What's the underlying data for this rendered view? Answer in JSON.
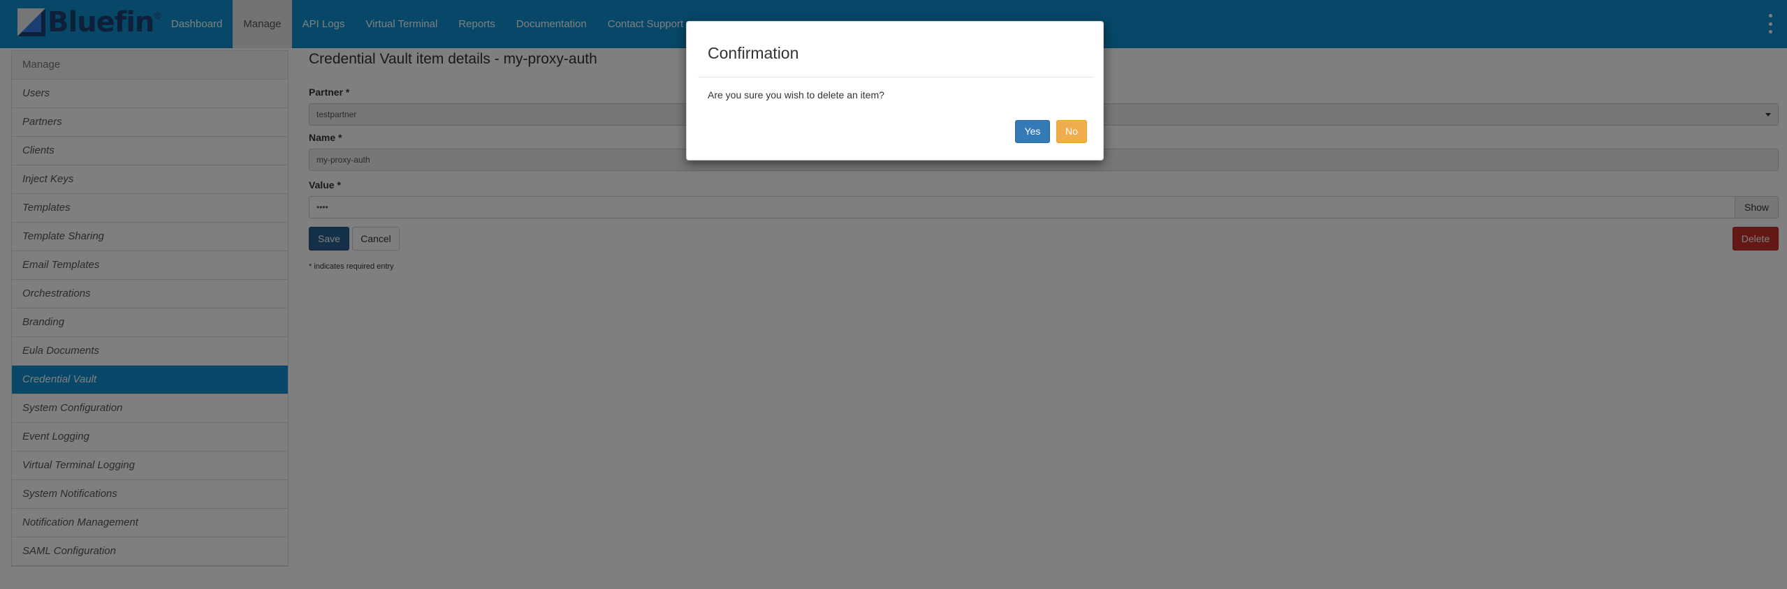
{
  "brand": {
    "name": "Bluefin",
    "reg": "®"
  },
  "nav": {
    "items": [
      {
        "label": "Dashboard"
      },
      {
        "label": "Manage",
        "active": true
      },
      {
        "label": "API Logs"
      },
      {
        "label": "Virtual Terminal"
      },
      {
        "label": "Reports"
      },
      {
        "label": "Documentation"
      },
      {
        "label": "Contact Support"
      }
    ]
  },
  "sidebar": {
    "header": "Manage",
    "items": [
      {
        "label": "Users"
      },
      {
        "label": "Partners"
      },
      {
        "label": "Clients"
      },
      {
        "label": "Inject Keys"
      },
      {
        "label": "Templates"
      },
      {
        "label": "Template Sharing"
      },
      {
        "label": "Email Templates"
      },
      {
        "label": "Orchestrations"
      },
      {
        "label": "Branding"
      },
      {
        "label": "Eula Documents"
      },
      {
        "label": "Credential Vault",
        "active": true
      },
      {
        "label": "System Configuration"
      },
      {
        "label": "Event Logging"
      },
      {
        "label": "Virtual Terminal Logging"
      },
      {
        "label": "System Notifications"
      },
      {
        "label": "Notification Management"
      },
      {
        "label": "SAML Configuration"
      }
    ]
  },
  "form": {
    "title": "Credential Vault item details - my-proxy-auth",
    "partner_label": "Partner *",
    "partner_value": "testpartner",
    "name_label": "Name *",
    "name_value": "my-proxy-auth",
    "value_label": "Value *",
    "value_masked": "••••",
    "show_label": "Show",
    "save_label": "Save",
    "cancel_label": "Cancel",
    "delete_label": "Delete",
    "required_note": "* indicates required entry"
  },
  "modal": {
    "title": "Confirmation",
    "message": "Are you sure you wish to delete an item?",
    "yes_label": "Yes",
    "no_label": "No"
  },
  "colors": {
    "navbar": "#0e8fce",
    "brand": "#1c3f73",
    "primary": "#337ab7",
    "warning": "#f0ad4e",
    "danger": "#c9302c"
  }
}
